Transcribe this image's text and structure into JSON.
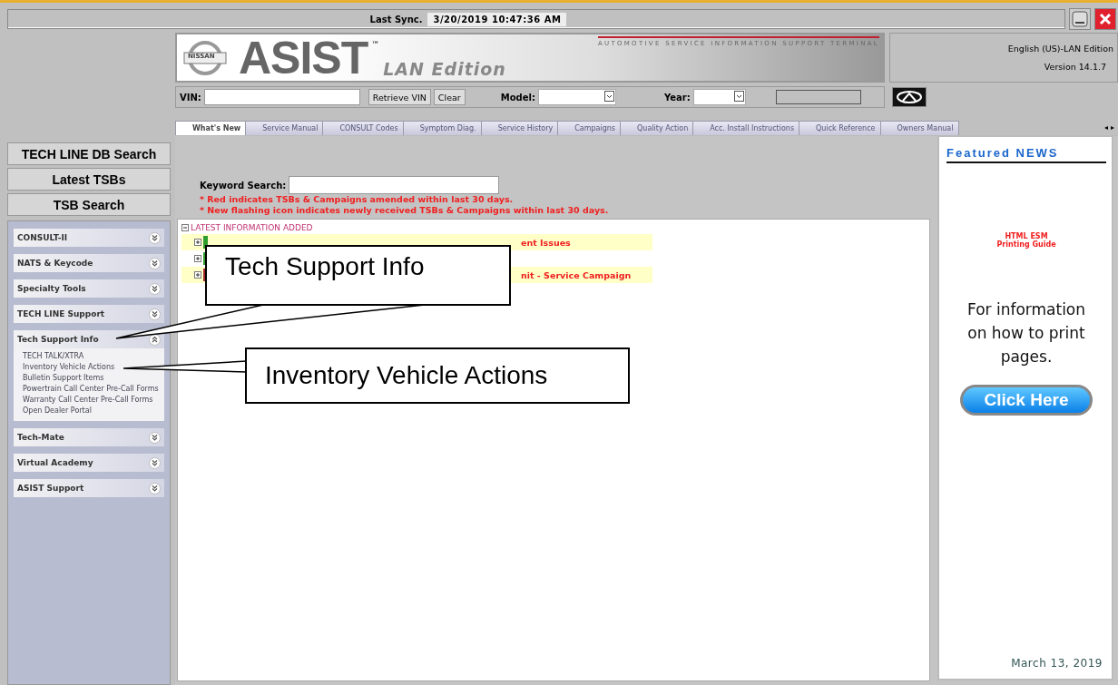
{
  "sync": {
    "label": "Last Sync.",
    "value": "3/20/2019 10:47:36 AM"
  },
  "banner": {
    "brand": "NISSAN",
    "title": "ASIST",
    "tm": "™",
    "edition": "LAN Edition",
    "tagline": "AUTOMOTIVE SERVICE INFORMATION SUPPORT TERMINAL"
  },
  "info": {
    "edition": "English (US)-LAN Edition",
    "version": "Version 14.1.7"
  },
  "vin_bar": {
    "vin_label": "VIN:",
    "retrieve": "Retrieve VIN",
    "clear": "Clear",
    "model_label": "Model:",
    "year_label": "Year:"
  },
  "tabs": [
    {
      "label": "What's New",
      "selected": true
    },
    {
      "label": "Service Manual",
      "selected": false
    },
    {
      "label": "CONSULT Codes",
      "selected": false
    },
    {
      "label": "Symptom Diag.",
      "selected": false
    },
    {
      "label": "Service History",
      "selected": false
    },
    {
      "label": "Campaigns",
      "selected": false
    },
    {
      "label": "Quality Action",
      "selected": false
    },
    {
      "label": "Acc. Install Instructions",
      "selected": false
    },
    {
      "label": "Quick Reference",
      "selected": false
    },
    {
      "label": "Owners Manual",
      "selected": false
    }
  ],
  "tab_scroll": [
    "◂",
    "▸"
  ],
  "sidebar_buttons": [
    "TECH LINE DB Search",
    "Latest TSBs",
    "TSB Search"
  ],
  "sections": [
    {
      "label": "CONSULT-II",
      "expanded": false
    },
    {
      "label": "NATS & Keycode",
      "expanded": false
    },
    {
      "label": "Specialty Tools",
      "expanded": false
    },
    {
      "label": "TECH LINE Support",
      "expanded": false
    },
    {
      "label": "Tech Support Info",
      "expanded": true,
      "children": [
        "TECH TALK/XTRA",
        "Inventory Vehicle Actions",
        "Bulletin Support Items",
        "Powertrain Call Center Pre-Call Forms",
        "Warranty Call Center Pre-Call Forms",
        "Open Dealer Portal"
      ]
    },
    {
      "label": "Tech-Mate",
      "expanded": false
    },
    {
      "label": "Virtual Academy",
      "expanded": false
    },
    {
      "label": "ASIST Support",
      "expanded": false
    }
  ],
  "keyword": {
    "label": "Keyword Search:"
  },
  "notes": [
    "* Red indicates TSBs & Campaigns amended within last 30 days.",
    "* New flashing icon indicates newly received TSBs & Campaigns within last 30 days."
  ],
  "latest": {
    "heading": "LATEST INFORMATION ADDED",
    "rows": [
      {
        "highlighted": true,
        "color": "#2e9e2e",
        "text": "ent Issues"
      },
      {
        "highlighted": false,
        "color": "#2e9e2e"
      },
      {
        "highlighted": true,
        "color": "#a02828",
        "text": "nit - Service Campaign"
      }
    ]
  },
  "featured": {
    "title": "Featured NEWS",
    "guide": [
      "HTML ESM",
      "Printing Guide"
    ],
    "body": "For information on how to print pages.",
    "button": "Click Here",
    "date": "March 13, 2019"
  },
  "callouts": [
    "Tech Support Info",
    "Inventory Vehicle Actions"
  ]
}
